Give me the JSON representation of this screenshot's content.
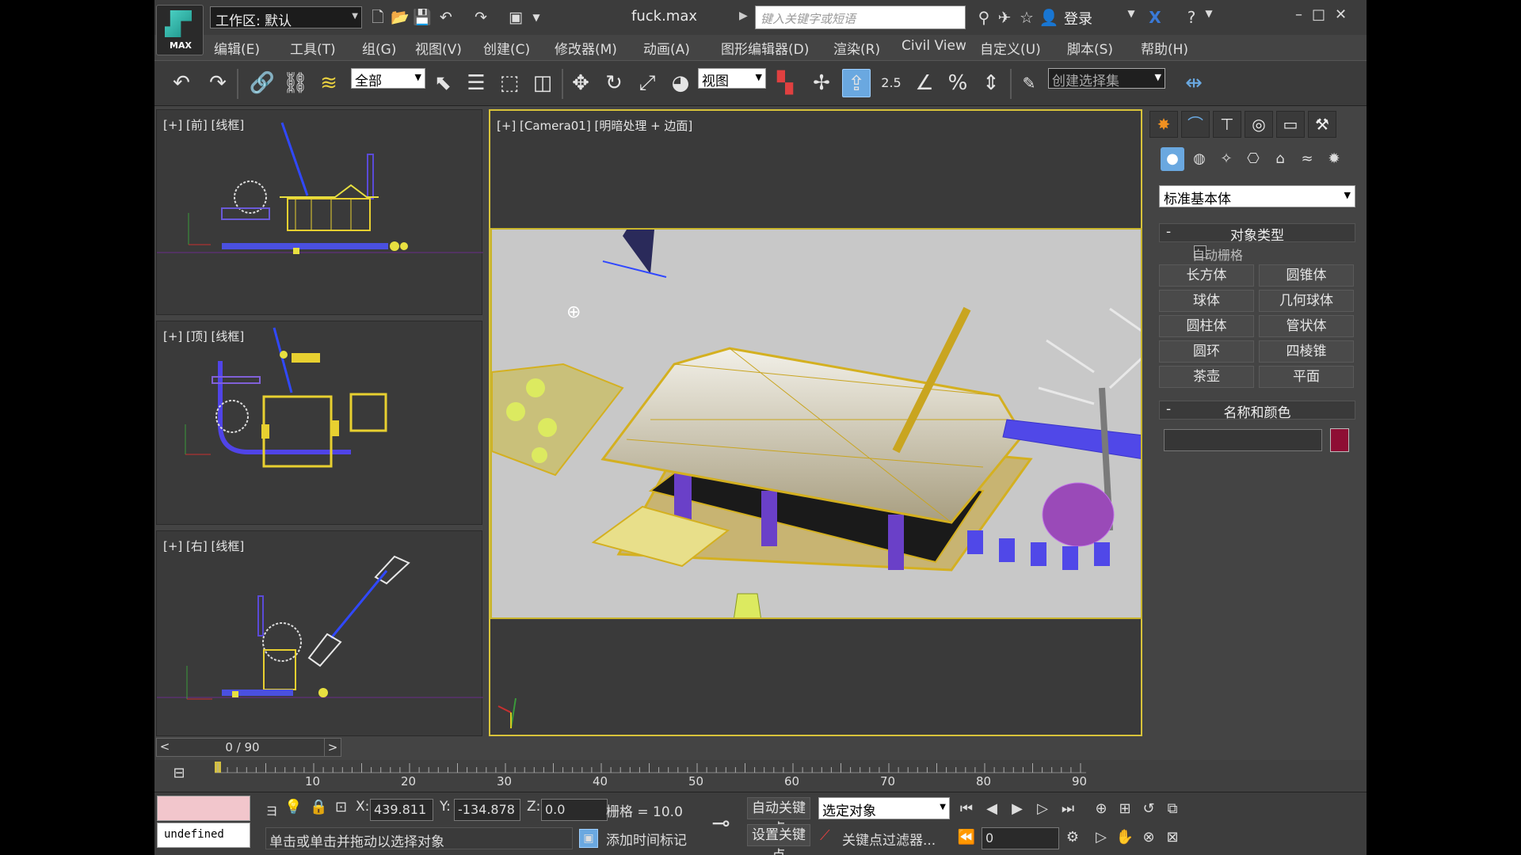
{
  "title_bar": {
    "logo_text": "MAX",
    "workspace": "工作区: 默认",
    "filename": "fuck.max",
    "search_placeholder": "键入关键字或短语",
    "login": "登录"
  },
  "menu": [
    "编辑(E)",
    "工具(T)",
    "组(G)",
    "视图(V)",
    "创建(C)",
    "修改器(M)",
    "动画(A)",
    "图形编辑器(D)",
    "渲染(R)",
    "Civil View",
    "自定义(U)",
    "脚本(S)",
    "帮助(H)"
  ],
  "toolbar": {
    "filter": "全部",
    "ref_coord": "视图",
    "snap_angle": "2.5",
    "selset_placeholder": "创建选择集"
  },
  "viewports": {
    "front": "[+] [前] [线框]",
    "top": "[+] [顶] [线框]",
    "right": "[+] [右] [线框]",
    "camera": "[+] [Camera01] [明暗处理 + 边面]"
  },
  "command_panel": {
    "category": "标准基本体",
    "object_type_header": "对象类型",
    "autogrid": "自动栅格",
    "buttons": [
      "长方体",
      "圆锥体",
      "球体",
      "几何球体",
      "圆柱体",
      "管状体",
      "圆环",
      "四棱锥",
      "茶壶",
      "平面"
    ],
    "name_color_header": "名称和颜色",
    "object_color": "#8e0e34"
  },
  "time_slider": {
    "position": "0 / 90"
  },
  "trackbar": {
    "ticks": [
      "10",
      "20",
      "30",
      "40",
      "50",
      "60",
      "70",
      "80",
      "90"
    ]
  },
  "status": {
    "undefined_text": "undefined",
    "x_label": "X:",
    "x_value": "439.811",
    "y_label": "Y:",
    "y_value": "-134.878",
    "z_label": "Z:",
    "z_value": "0.0",
    "grid": "栅格 = 10.0",
    "prompt": "单击或单击并拖动以选择对象",
    "add_time_tag": "添加时间标记",
    "auto_key": "自动关键点",
    "set_key": "设置关键点",
    "selected_object": "选定对象",
    "key_filters": "关键点过滤器...",
    "frame": "0"
  }
}
